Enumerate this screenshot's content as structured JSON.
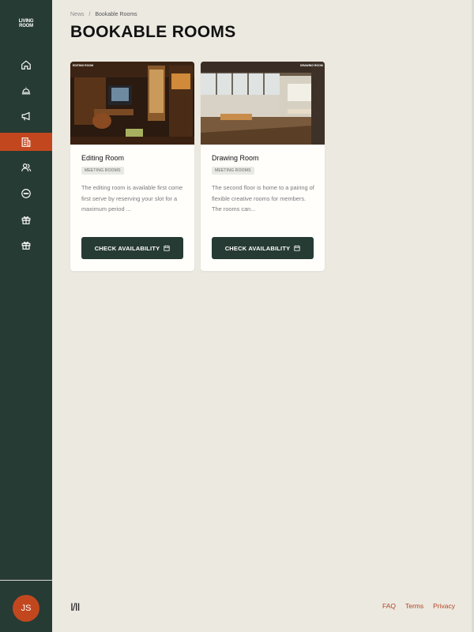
{
  "app": {
    "logo_line1": "LIVING",
    "logo_line2": "ROOM",
    "avatar_initials": "JS",
    "accent_color": "#c2471f",
    "sidebar_color": "#263b33"
  },
  "sidebar": {
    "items": [
      {
        "icon": "home-icon",
        "active": false
      },
      {
        "icon": "cloche-icon",
        "active": false
      },
      {
        "icon": "megaphone-icon",
        "active": false
      },
      {
        "icon": "rooms-icon",
        "active": true
      },
      {
        "icon": "members-icon",
        "active": false
      },
      {
        "icon": "chat-icon",
        "active": false
      },
      {
        "icon": "gift-icon",
        "active": false
      },
      {
        "icon": "gift-icon",
        "active": false
      }
    ]
  },
  "breadcrumb": {
    "parent": "News",
    "separator": "/",
    "current": "Bookable Rooms"
  },
  "page": {
    "title": "BOOKABLE ROOMS"
  },
  "rooms": [
    {
      "image_label": "EDITING ROOM",
      "title": "Editing Room",
      "tag": "MEETING ROOMS",
      "description": "The editing room is available first come first serve by reserving your slot for a maximum period ...",
      "button_label": "CHECK AVAILABILITY"
    },
    {
      "image_label": "DRAWING ROOM",
      "title": "Drawing Room",
      "tag": "MEETING ROOMS",
      "description": "The second floor is home to a pairing of flexible creative rooms for members. The rooms can...",
      "button_label": "CHECK AVAILABILITY"
    }
  ],
  "footer": {
    "logo": "I/II",
    "links": [
      "FAQ",
      "Terms",
      "Privacy"
    ]
  }
}
